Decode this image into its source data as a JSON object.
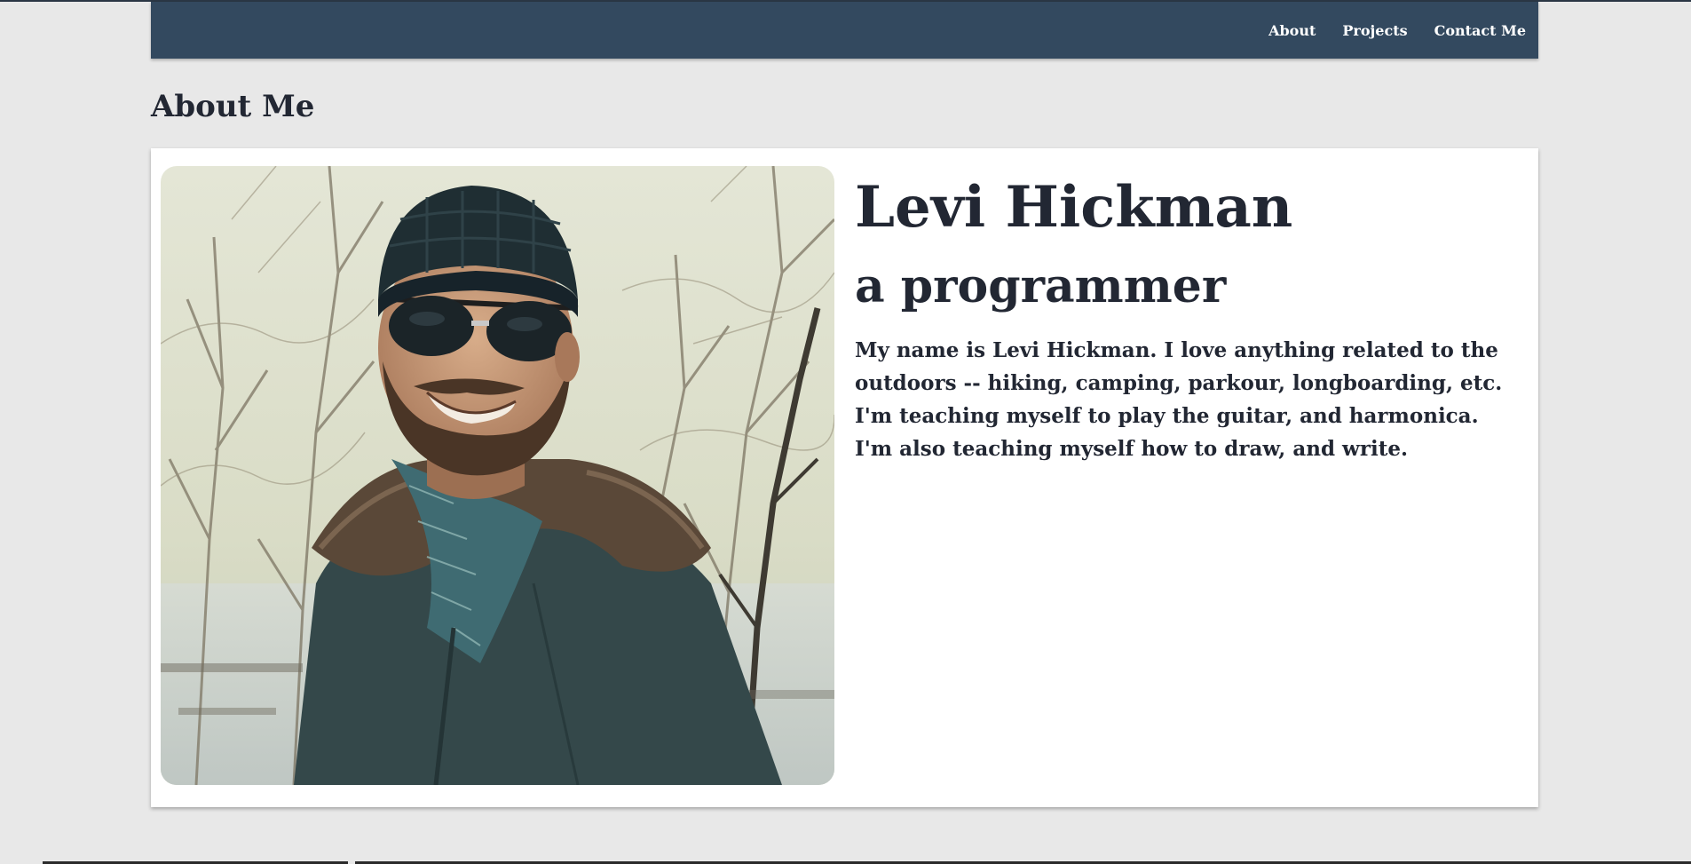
{
  "nav": {
    "links": [
      {
        "label": "About"
      },
      {
        "label": "Projects"
      },
      {
        "label": "Contact Me"
      }
    ]
  },
  "section": {
    "title": "About Me"
  },
  "profile": {
    "name": "Levi Hickman",
    "role": "a programmer",
    "description": "My name is Levi Hickman. I love anything related to the outdoors -- hiking, camping, parkour, longboarding, etc. I'm teaching myself to play the guitar, and harmonica. I'm also teaching myself how to draw, and write.",
    "photo_subject": "portrait-photo"
  },
  "colors": {
    "navbar": "#33495f",
    "background": "#e8e8e8",
    "card": "#ffffff",
    "text": "#222733"
  }
}
